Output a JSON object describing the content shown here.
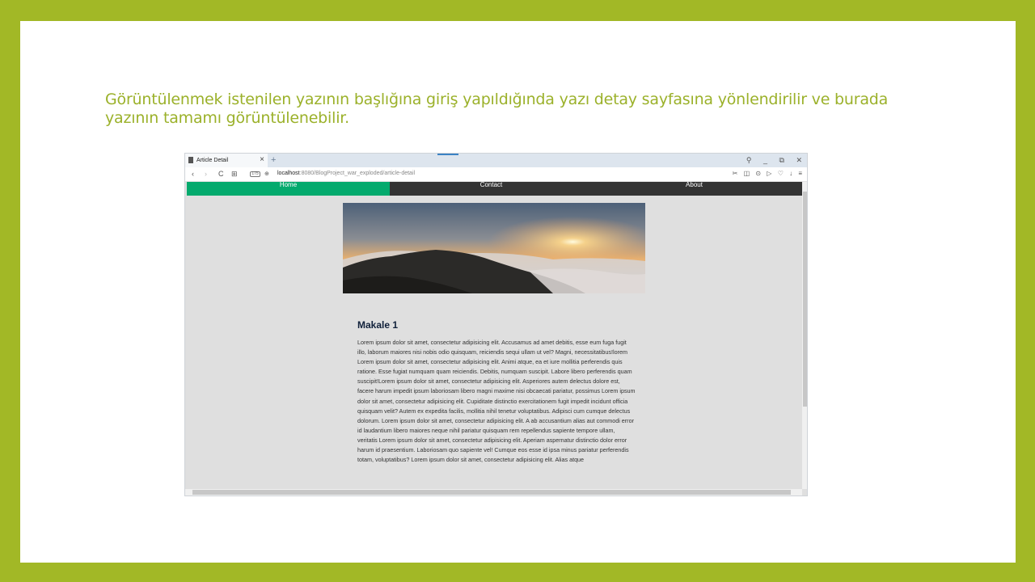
{
  "slide": {
    "caption_line1": "Görüntülenmek istenilen yazının başlığına giriş yapıldığında yazı detay sayfasına yönlendirilir ve burada",
    "caption_line2": "yazının tamamı görüntülenebilir."
  },
  "browser": {
    "tab_title": "Article Detail",
    "tab_close": "×",
    "new_tab": "+",
    "window_controls": [
      "⚲",
      "_",
      "⧉",
      "✕"
    ],
    "nav_icons": [
      "‹",
      "›",
      "C",
      "⊞"
    ],
    "badge": "175",
    "url_host": "localhost",
    "url_rest": ":8080/BlogProject_war_exploded/article-detail",
    "tool_icons": [
      "✂",
      "◫",
      "⊙",
      "▷",
      "♡",
      "↓",
      "≡"
    ]
  },
  "site": {
    "nav": [
      "Home",
      "Contact",
      "About"
    ],
    "article_title": "Makale 1",
    "article_body": "Lorem ipsum dolor sit amet, consectetur adipisicing elit. Accusamus ad amet debitis, esse eum fuga fugit illo, laborum maiores nisi nobis odio quisquam, reiciendis sequi ullam ut vel? Magni, necessitatibus!lorem Lorem ipsum dolor sit amet, consectetur adipisicing elit. Animi atque, ea et iure mollitia perferendis quis ratione. Esse fugiat numquam quam reiciendis. Debitis, numquam suscipit. Labore libero perferendis quam suscipit!Lorem ipsum dolor sit amet, consectetur adipisicing elit. Asperiores autem delectus dolore est, facere harum impedit ipsum laboriosam libero magni maxime nisi obcaecati pariatur, possimus Lorem ipsum dolor sit amet, consectetur adipisicing elit. Cupiditate distinctio exercitationem fugit impedit incidunt officia quisquam velit? Autem ex expedita facilis, mollitia nihil tenetur voluptatibus. Adipisci cum cumque delectus dolorum. Lorem ipsum dolor sit amet, consectetur adipisicing elit. A ab accusantium alias aut commodi error id laudantium libero maiores neque nihil pariatur quisquam rem repellendus sapiente tempore ullam, veritatis Lorem ipsum dolor sit amet, consectetur adipisicing elit. Aperiam aspernatur distinctio dolor error harum id praesentium. Laboriosam quo sapiente vel! Cumque eos esse id ipsa minus pariatur perferendis totam, voluptatibus? Lorem ipsum dolor sit amet, consectetur adipisicing elit. Alias atque"
  },
  "colors": {
    "slide_border": "#a2b826",
    "caption": "#9bb12a",
    "nav_active": "#04aa6d",
    "nav_bg": "#333333",
    "page_bg": "#dfdfdf"
  }
}
